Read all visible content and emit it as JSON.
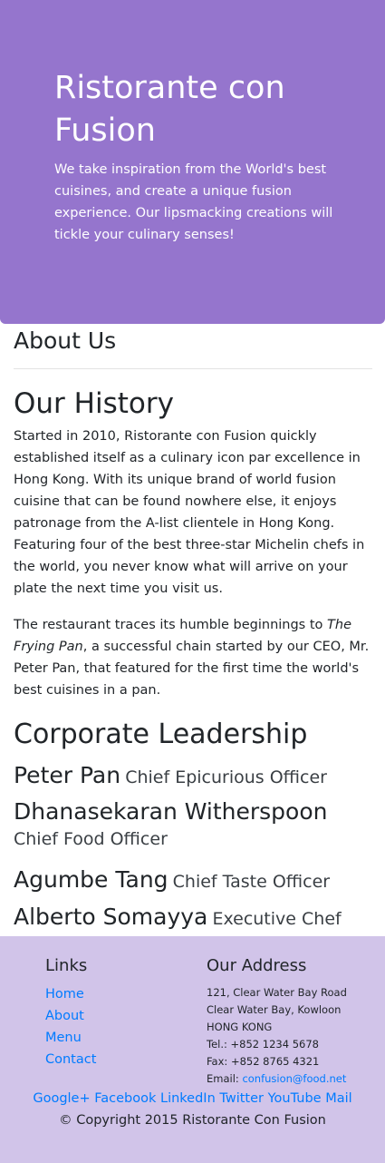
{
  "jumbotron": {
    "title": "Ristorante con Fusion",
    "text": "We take inspiration from the World's best cuisines, and create a unique fusion experience. Our lipsmacking creations will tickle your culinary senses!"
  },
  "about": {
    "heading": "About Us",
    "history_heading": "Our History",
    "p1": "Started in 2010, Ristorante con Fusion quickly established itself as a culinary icon par excellence in Hong Kong. With its unique brand of world fusion cuisine that can be found nowhere else, it enjoys patronage from the A-list clientele in Hong Kong. Featuring four of the best three-star Michelin chefs in the world, you never know what will arrive on your plate the next time you visit us.",
    "p2_before": "The restaurant traces its humble beginnings to ",
    "p2_italic": "The Frying Pan",
    "p2_after": ", a successful chain started by our CEO, Mr. Peter Pan, that featured for the first time the world's best cuisines in a pan."
  },
  "leadership": {
    "heading": "Corporate Leadership",
    "leaders": [
      {
        "name": "Peter Pan",
        "role": "Chief Epicurious Officer"
      },
      {
        "name": "Dhanasekaran Witherspoon",
        "role": "Chief Food Officer"
      },
      {
        "name": "Agumbe Tang",
        "role": "Chief Taste Officer"
      },
      {
        "name": "Alberto Somayya",
        "role": "Executive Chef"
      }
    ]
  },
  "footer": {
    "links_heading": "Links",
    "links": [
      "Home",
      "About",
      "Menu",
      "Contact"
    ],
    "address_heading": "Our Address",
    "address_lines": [
      "121, Clear Water Bay Road",
      "Clear Water Bay, Kowloon",
      "HONG KONG"
    ],
    "tel": "Tel.: +852 1234 5678",
    "fax": "Fax: +852 8765 4321",
    "email_label": "Email: ",
    "email": "confusion@food.net",
    "social": [
      "Google+",
      "Facebook",
      "LinkedIn",
      "Twitter",
      "YouTube",
      "Mail"
    ],
    "copyright": "© Copyright 2015 Ristorante Con Fusion"
  },
  "colors": {
    "jumbotron_bg": "#9575cd",
    "footer_bg": "#d1c4e9",
    "link": "#007bff"
  }
}
